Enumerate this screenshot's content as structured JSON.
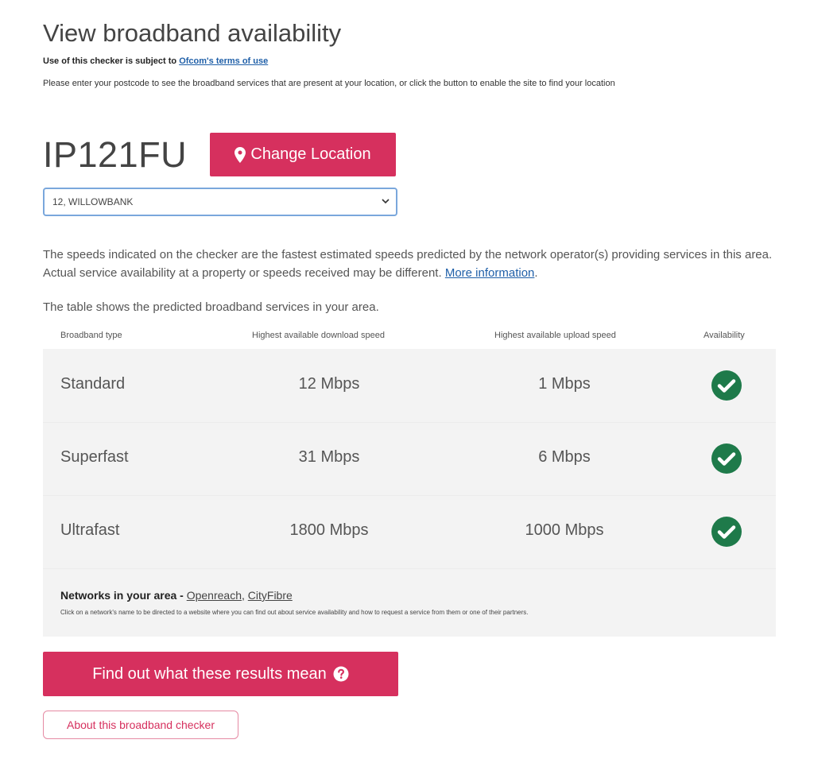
{
  "header": {
    "title": "View broadband availability",
    "terms_prefix": "Use of this checker is subject to",
    "terms_link": "Ofcom's terms of use",
    "intro": "Please enter your postcode to see the broadband services that are present at your location, or click the button to enable the site to find your location"
  },
  "location": {
    "postcode": "IP121FU",
    "change_button": "Change Location",
    "change_icon": "map-pin-icon",
    "address_selected": "12, WILLOWBANK"
  },
  "disclaimer": {
    "text": "The speeds indicated on the checker are the fastest estimated speeds predicted by the network operator(s) providing services in this area. Actual service availability at a property or speeds received may be different.",
    "link": "More information",
    "suffix": "."
  },
  "table": {
    "caption": "The table shows the predicted broadband services in your area.",
    "headers": {
      "type": "Broadband type",
      "download": "Highest available download speed",
      "upload": "Highest available upload speed",
      "availability": "Availability"
    },
    "rows": [
      {
        "type": "Standard",
        "download": "12 Mbps",
        "upload": "1 Mbps",
        "available_icon": "check-circle-icon"
      },
      {
        "type": "Superfast",
        "download": "31 Mbps",
        "upload": "6 Mbps",
        "available_icon": "check-circle-icon"
      },
      {
        "type": "Ultrafast",
        "download": "1800 Mbps",
        "upload": "1000 Mbps",
        "available_icon": "check-circle-icon"
      }
    ],
    "networks_label": "Networks in your area -",
    "networks": [
      "Openreach",
      "CityFibre"
    ],
    "networks_separator": ",",
    "networks_note": "Click on a network's name to be directed to a website where you can find out about service availability and how to request a service from them or one of their partners."
  },
  "actions": {
    "results_button": "Find out what these results mean",
    "results_icon": "question-circle-icon",
    "about_button": "About this broadband checker"
  },
  "colors": {
    "accent": "#d6305e",
    "check": "#1e7a4a",
    "link": "#1f5fa8",
    "table_bg": "#f3f3f3"
  }
}
